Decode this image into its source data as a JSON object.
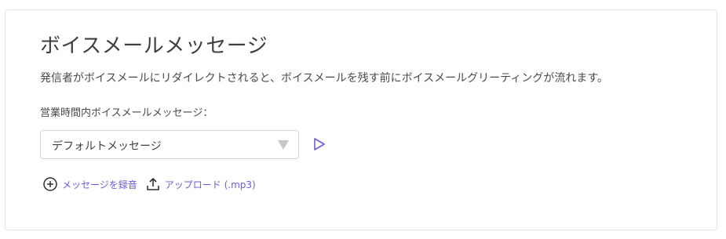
{
  "voicemail": {
    "title": "ボイスメールメッセージ",
    "description": "発信者がボイスメールにリダイレクトされると、ボイスメールを残す前にボイスメールグリーティングが流れます。",
    "business_hours_label": "営業時間内ボイスメールメッセージ：",
    "selected_message": "デフォルトメッセージ",
    "record_label": "メッセージを録音",
    "upload_label": "アップロード (.mp3)"
  },
  "colors": {
    "accent": "#6b5bd6",
    "text": "#3f3f3f",
    "border": "#d2d2d2"
  },
  "icons": {
    "play": "play-icon",
    "record": "plus-circle-icon",
    "upload": "upload-icon",
    "dropdown": "caret-down-icon"
  }
}
